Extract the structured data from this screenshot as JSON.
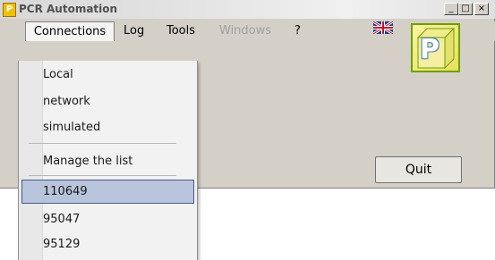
{
  "window": {
    "title": "PCR Automation",
    "app_icon_letter": "P",
    "controls": {
      "minimize": "_",
      "maximize": "□",
      "close": "×"
    }
  },
  "menubar": {
    "items": [
      {
        "label": "Connections",
        "state": "open"
      },
      {
        "label": "Log"
      },
      {
        "label": "Tools"
      },
      {
        "label": "Windows",
        "state": "disabled"
      },
      {
        "label": "?"
      }
    ],
    "language_flag": "uk-flag-icon"
  },
  "logo": {
    "letter": "P"
  },
  "quit_button": {
    "label": "Quit"
  },
  "connections_menu": {
    "items": [
      {
        "label": "Local"
      },
      {
        "label": "network"
      },
      {
        "label": "simulated"
      },
      {
        "label": "Manage the list"
      },
      {
        "label": "110649",
        "selected": true
      },
      {
        "label": "95047"
      },
      {
        "label": "95129"
      }
    ]
  },
  "colors": {
    "window_bg": "#d4d0c8",
    "selection_bg": "#b8c4dc",
    "selection_border": "#4a5c8c"
  }
}
